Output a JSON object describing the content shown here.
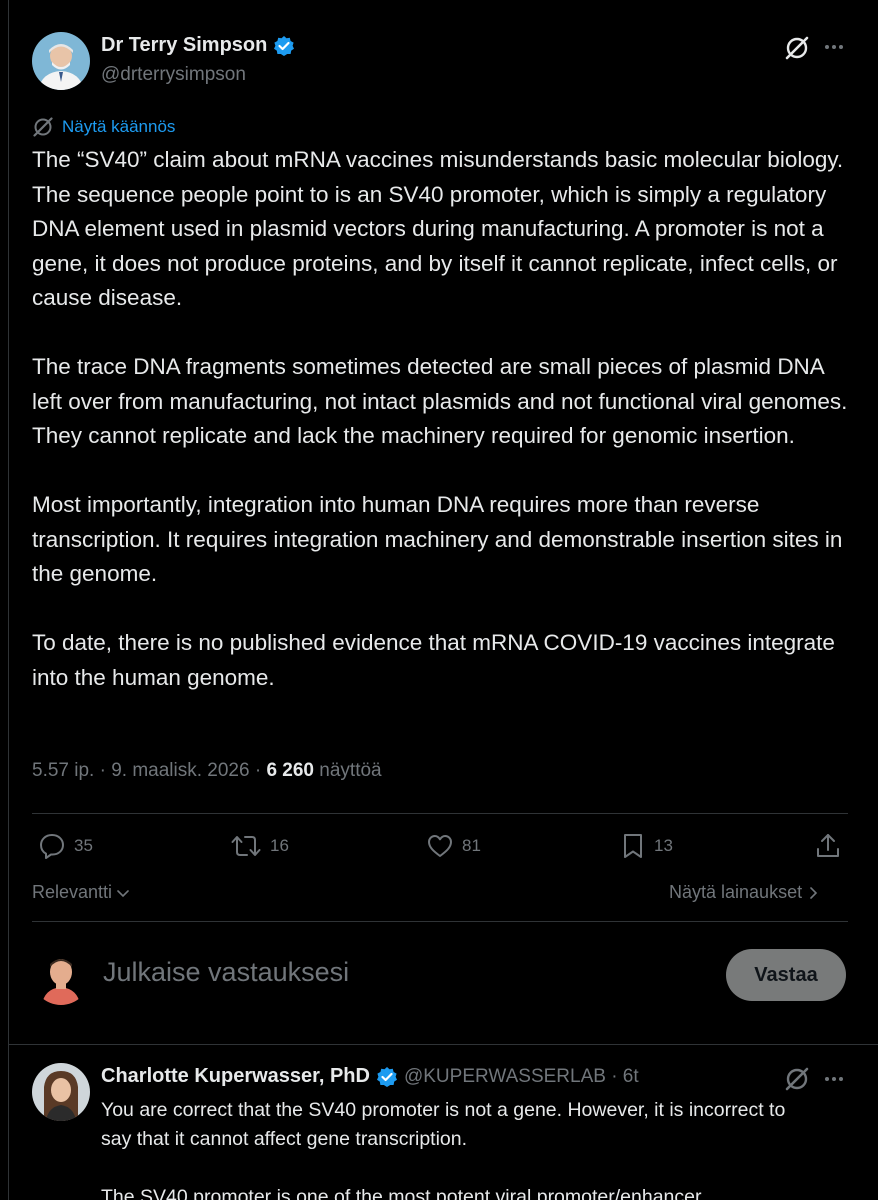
{
  "post": {
    "author_name": "Dr Terry Simpson",
    "handle": "@drterrysimpson",
    "translate_label": "Näytä käännös",
    "paragraphs": [
      "The “SV40” claim about mRNA vaccines misunderstands basic molecular biology. The sequence people point to is an SV40 promoter, which is simply a regulatory DNA element used in plasmid vectors during manufacturing. A promoter is not a gene, it does not produce proteins, and by itself it cannot replicate, infect cells, or cause disease.",
      "The trace DNA fragments sometimes detected are small pieces of plasmid DNA left over from manufacturing, not intact plasmids and not functional viral genomes. They cannot replicate and lack the machinery required for genomic insertion.",
      "Most importantly, integration into human DNA requires more than reverse transcription. It requires integration machinery and demonstrable insertion sites in the genome.",
      "To date, there is no published evidence that mRNA COVID-19 vaccines integrate into the human genome."
    ],
    "timestamp": "5.57 ip. · 9. maalisk. 2026 ·",
    "views_count": "6 260",
    "views_label": "näyttöä",
    "actions": {
      "replies": "35",
      "reposts": "16",
      "likes": "81",
      "bookmarks": "13"
    }
  },
  "sort": {
    "left_label": "Relevantti",
    "right_label": "Näytä lainaukset"
  },
  "composer": {
    "placeholder": "Julkaise vastauksesi",
    "reply_button": "Vastaa"
  },
  "reply": {
    "author_name": "Charlotte Kuperwasser, PhD",
    "handle_time": "@KUPERWASSERLAB · 6t",
    "paragraphs": [
      "You are correct that the SV40 promoter is not a gene. However, it is incorrect to say that it cannot affect gene transcription.",
      "The SV40 promoter is one of the most potent viral promoter/enhancer"
    ]
  },
  "colors": {
    "accent": "#1d9bf0",
    "muted": "#71767b",
    "text": "#e7e9ea",
    "divider": "#2f3336"
  }
}
